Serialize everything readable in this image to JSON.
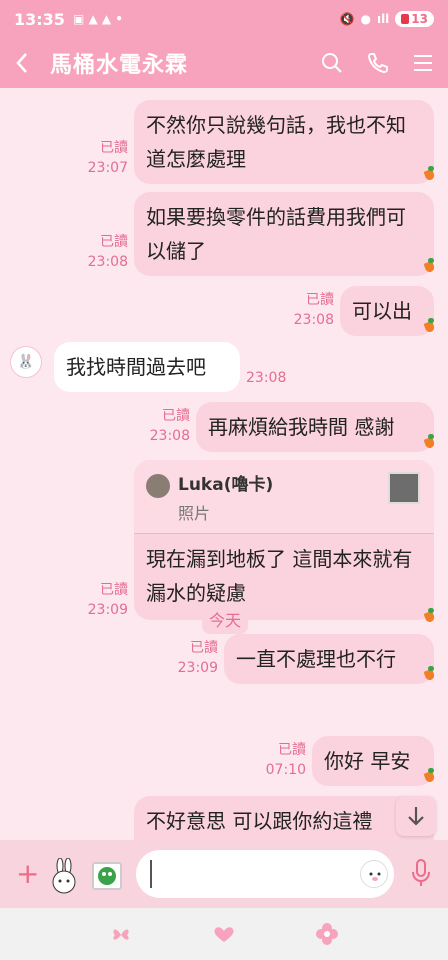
{
  "status_bar": {
    "time": "13:35",
    "battery": "13"
  },
  "header": {
    "back_icon": "chevron-left",
    "title": "馬桶水電永霖",
    "search_icon": "search",
    "call_icon": "phone",
    "menu_icon": "hamburger"
  },
  "messages": [
    {
      "direction": "out",
      "text": "不然你只說幾句話，我也不知道怎麼處理",
      "read": "已讀",
      "time": "23:07"
    },
    {
      "direction": "out",
      "text": "如果要換零件的話費用我們可以儲了",
      "read": "已讀",
      "time": "23:08"
    },
    {
      "direction": "out",
      "text": "可以出",
      "read": "已讀",
      "time": "23:08"
    },
    {
      "direction": "in",
      "text": "我找時間過去吧",
      "time": "23:08"
    },
    {
      "direction": "out",
      "text": "再麻煩給我時間 感謝",
      "read": "已讀",
      "time": "23:08"
    },
    {
      "direction": "out",
      "reply_to": {
        "name": "Luka(嚕卡)",
        "type": "照片"
      },
      "text": "現在漏到地板了 這間本來就有漏水的疑慮",
      "read": "已讀",
      "time": "23:09"
    },
    {
      "direction": "out",
      "text": "一直不處理也不行",
      "read": "已讀",
      "time": "23:09"
    },
    {
      "direction": "out",
      "text": "你好 早安",
      "read": "已讀",
      "time": "07:10"
    },
    {
      "direction": "out",
      "text": "不好意思 可以跟你約這禮"
    }
  ],
  "date_divider": "今天",
  "input": {
    "placeholder": ""
  },
  "colors": {
    "accent": "#f8a3bd",
    "bubble_out": "#fbd3df",
    "read_text": "#e46e92"
  }
}
